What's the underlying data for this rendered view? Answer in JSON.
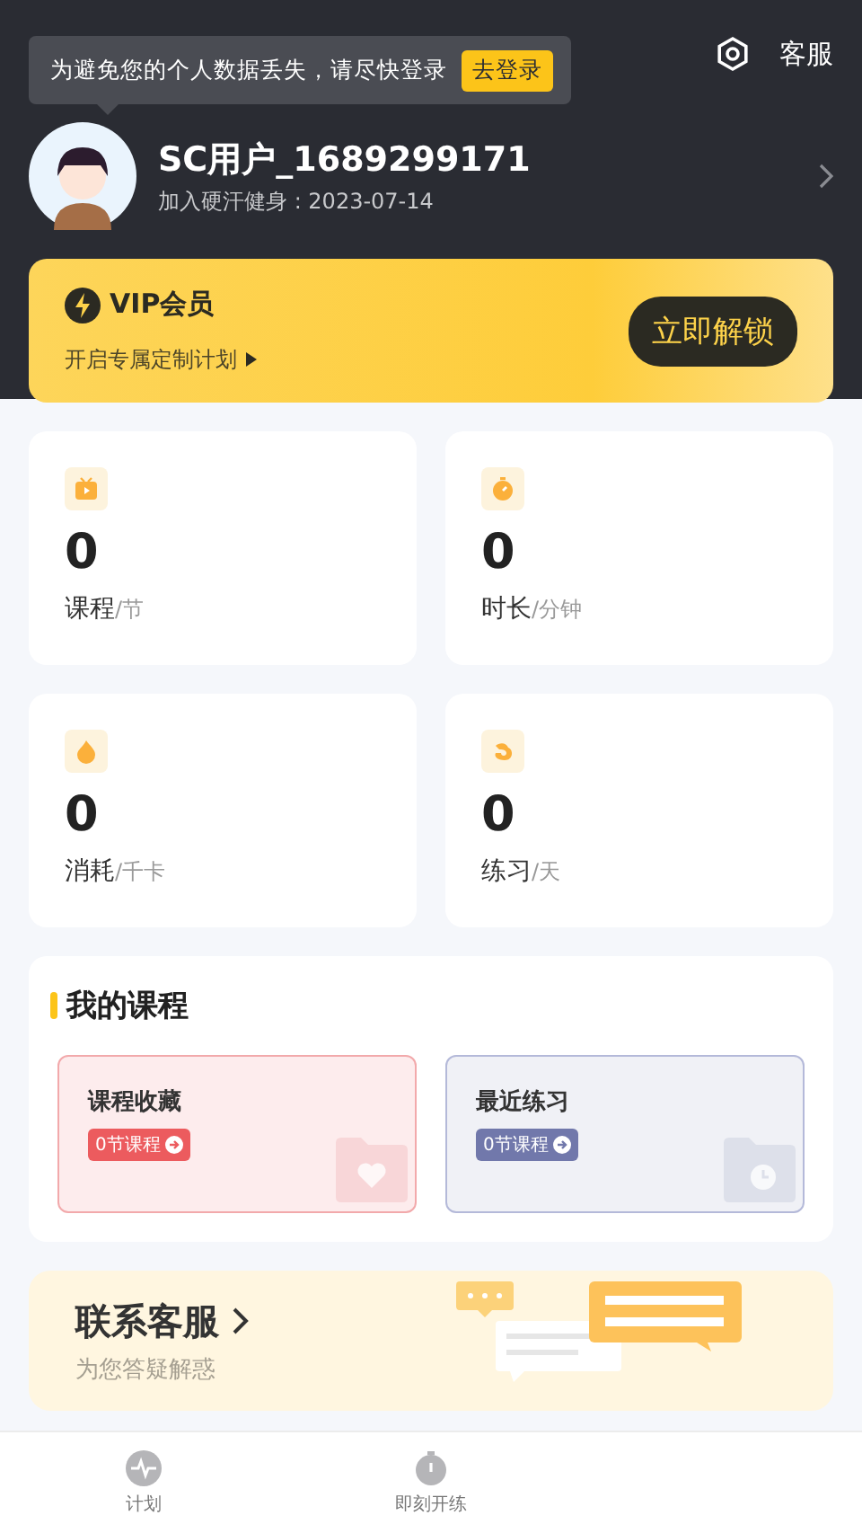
{
  "header": {
    "support_label": "客服",
    "login_tip": {
      "text": "为避免您的个人数据丢失，请尽快登录",
      "button": "去登录"
    },
    "user": {
      "name": "SC用户_1689299171",
      "joined": "加入硬汗健身 : 2023-07-14"
    }
  },
  "vip": {
    "title": "VIP会员",
    "subtitle": "开启专属定制计划",
    "button": "立即解锁"
  },
  "stats": [
    {
      "kind": "video",
      "value": "0",
      "label": "课程",
      "unit": "/节"
    },
    {
      "kind": "timer",
      "value": "0",
      "label": "时长",
      "unit": "/分钟"
    },
    {
      "kind": "flame",
      "value": "0",
      "label": "消耗",
      "unit": "/千卡"
    },
    {
      "kind": "muscle",
      "value": "0",
      "label": "练习",
      "unit": "/天"
    }
  ],
  "my_courses": {
    "title": "我的课程",
    "cards": [
      {
        "kind": "favorites",
        "title": "课程收藏",
        "badge": "0节课程"
      },
      {
        "kind": "recent",
        "title": "最近练习",
        "badge": "0节课程"
      }
    ]
  },
  "contact": {
    "title": "联系客服",
    "subtitle": "为您答疑解惑"
  },
  "tab_bar": [
    {
      "kind": "plan",
      "label": "计划",
      "selected": false
    },
    {
      "kind": "train",
      "label": "即刻开练",
      "selected": false
    }
  ]
}
